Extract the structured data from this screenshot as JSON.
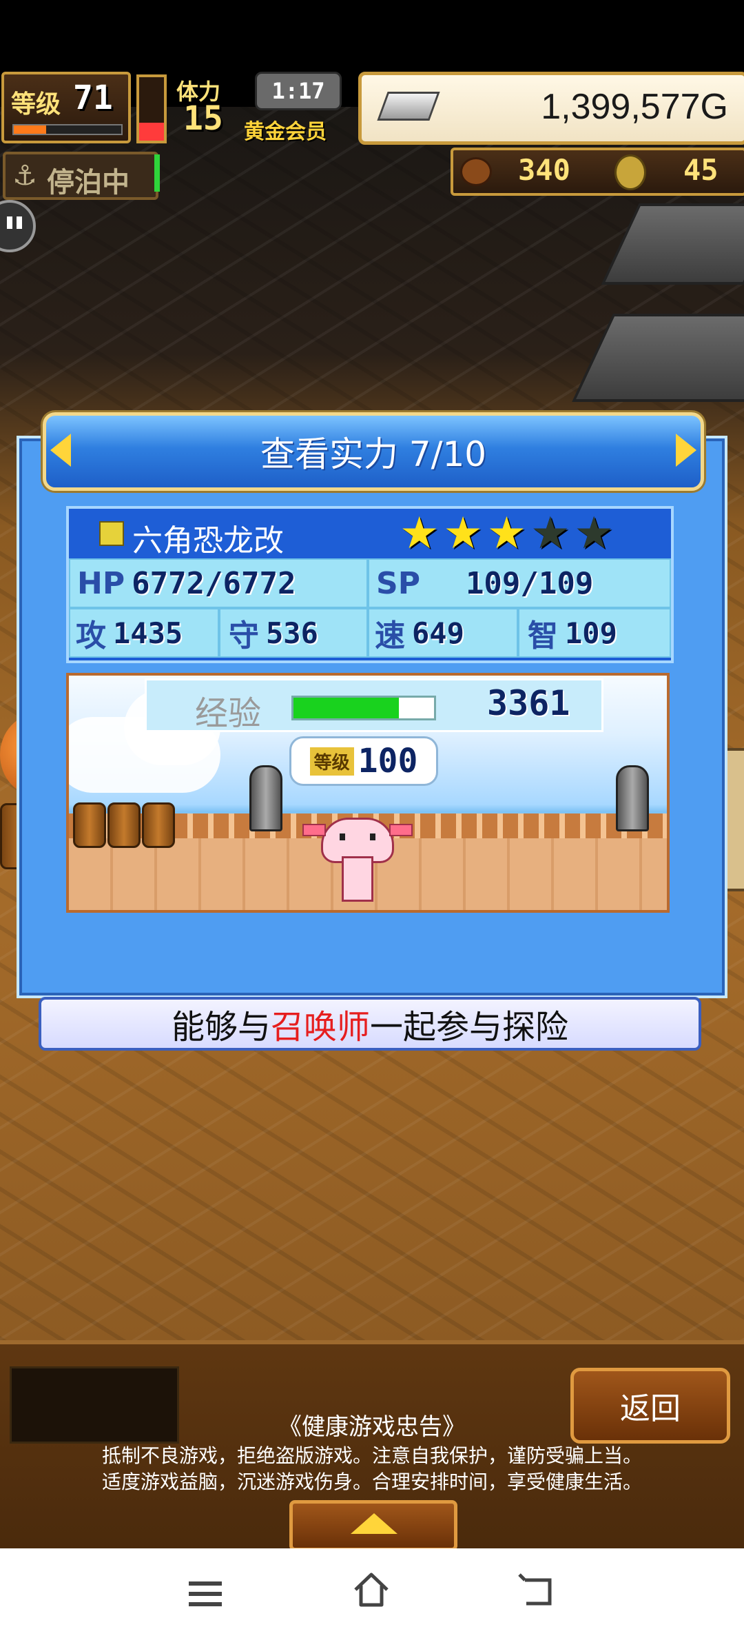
{
  "hud": {
    "level_label": "等级",
    "level_value": "71",
    "stamina_label": "体力",
    "stamina_value": "15",
    "timer": "1:17",
    "member": "黄金会员",
    "gold": "1,399,577G",
    "anchor_status": "停泊中",
    "resource_1": "340",
    "resource_2": "45"
  },
  "panel": {
    "title": "查看实力 7/10",
    "monster_name": "六角恐龙改",
    "stars_total": 5,
    "stars_filled": 3,
    "hp_label": "HP",
    "hp_value": "6772/6772",
    "sp_label": "SP",
    "sp_value": "109/109",
    "atk_label": "攻",
    "atk_value": "1435",
    "def_label": "守",
    "def_value": "536",
    "spd_label": "速",
    "spd_value": "649",
    "int_label": "智",
    "int_value": "109",
    "exp_label": "经验",
    "exp_value": "3361",
    "exp_fill": 0.75,
    "level_label": "等级",
    "level_value": "100"
  },
  "summon_prefix": "能够与",
  "summon_highlight": "召唤师",
  "summon_suffix": "一起参与探险",
  "footer": {
    "back_button": "返回",
    "notice_title": "《健康游戏忠告》",
    "notice_line1": "抵制不良游戏，拒绝盗版游戏。注意自我保护，谨防受骗上当。",
    "notice_line2": "适度游戏益脑，沉迷游戏伤身。合理安排时间，享受健康生活。"
  },
  "colors": {
    "panel_blue": "#4f9df2",
    "highlight_red": "#e61e1e",
    "star_yellow": "#ffe11a",
    "exp_green": "#19d21e"
  },
  "icons": {
    "nav_menu": "menu-icon",
    "nav_home": "home-icon",
    "nav_back": "back-icon"
  }
}
